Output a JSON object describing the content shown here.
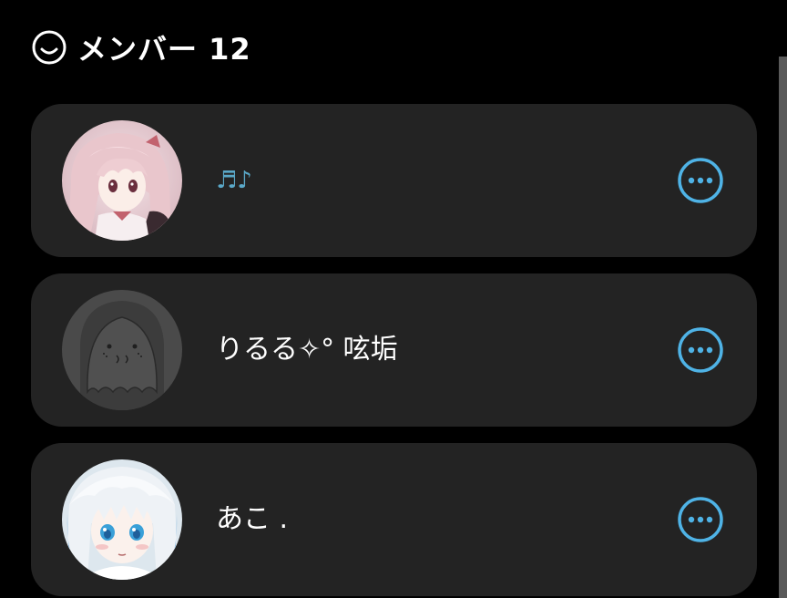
{
  "header": {
    "icon": "smile-face-icon",
    "title": "メンバー 12"
  },
  "members": [
    {
      "name": "♬♪",
      "avatar": "anime-girl-pink-hair-avatar",
      "action_icon": "more-horizontal-icon"
    },
    {
      "name": "りるる✧° 呟垢",
      "avatar": "ghost-sketch-avatar",
      "action_icon": "more-horizontal-icon"
    },
    {
      "name": "あこ .",
      "avatar": "anime-girl-blue-hair-avatar",
      "action_icon": "more-horizontal-icon"
    }
  ],
  "colors": {
    "background": "#000000",
    "card": "#232323",
    "accent": "#4fb3e6",
    "note_text": "#5aa8c8"
  }
}
